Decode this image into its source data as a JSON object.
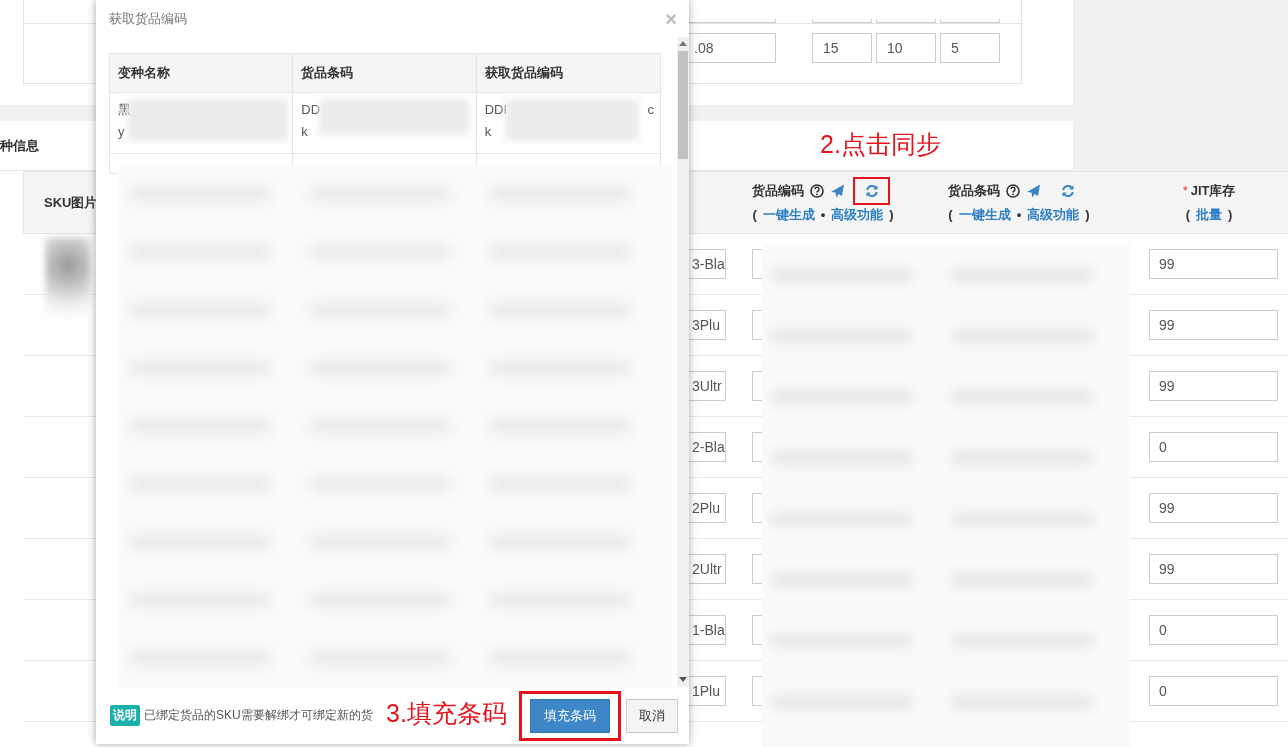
{
  "top_panel": {
    "dimension_fields": [
      {
        "value": ".08",
        "kind": "wide"
      },
      {
        "value": "15",
        "kind": "narrow"
      },
      {
        "value": "10",
        "kind": "narrow"
      },
      {
        "value": "5",
        "kind": "narrow"
      }
    ]
  },
  "variant_panel": {
    "title": "种信息",
    "columns": [
      {
        "title": "SKU图片",
        "kind": "plain"
      },
      {
        "title": "货品编码",
        "kind": "code",
        "annotated": true,
        "prefix": "(",
        "links": [
          "一键生成",
          "高级功能"
        ],
        "separator": "•",
        "suffix": ")"
      },
      {
        "title": "货品条码",
        "kind": "code",
        "prefix": "(",
        "links": [
          "一键生成",
          "高级功能"
        ],
        "separator": "•",
        "suffix": ")"
      },
      {
        "title": "JIT库存",
        "kind": "stock",
        "required_mark": "*",
        "prefix": "(",
        "links": [
          "批量"
        ],
        "suffix": ")"
      }
    ],
    "rows": [
      {
        "code_field": "3-Bla",
        "jit_stock": "99",
        "thumbnail": true
      },
      {
        "code_field": "3Plu",
        "jit_stock": "99"
      },
      {
        "code_field": "3Ultr",
        "jit_stock": "99"
      },
      {
        "code_field": "2-Bla",
        "jit_stock": "0"
      },
      {
        "code_field": "2Plu",
        "jit_stock": "99"
      },
      {
        "code_field": "2Ultr",
        "jit_stock": "99"
      },
      {
        "code_field": "1-Bla",
        "jit_stock": "0"
      },
      {
        "code_field": "1Plu",
        "jit_stock": "0"
      }
    ]
  },
  "dialog": {
    "title": "获取货品编码",
    "close": "×",
    "columns": [
      "变种名称",
      "货品条码",
      "获取货品编码"
    ],
    "rows": [
      {
        "cells": [
          {
            "lines": [
              "黑",
              "y"
            ]
          },
          {
            "lines": [
              "DD",
              "k"
            ]
          },
          {
            "lines": [
              "DDI",
              "k"
            ],
            "tail": "c"
          }
        ]
      }
    ],
    "note": {
      "badge": "说明",
      "text": "已绑定货品的SKU需要解绑才可绑定新的货"
    },
    "buttons": [
      {
        "label": "填充条码",
        "kind": "primary",
        "annotated": true
      },
      {
        "label": "取消",
        "kind": "default"
      }
    ]
  },
  "annotations": [
    {
      "text": "2.点击同步",
      "kind": "sync"
    },
    {
      "text": "3.填充条码",
      "kind": "fill"
    }
  ]
}
